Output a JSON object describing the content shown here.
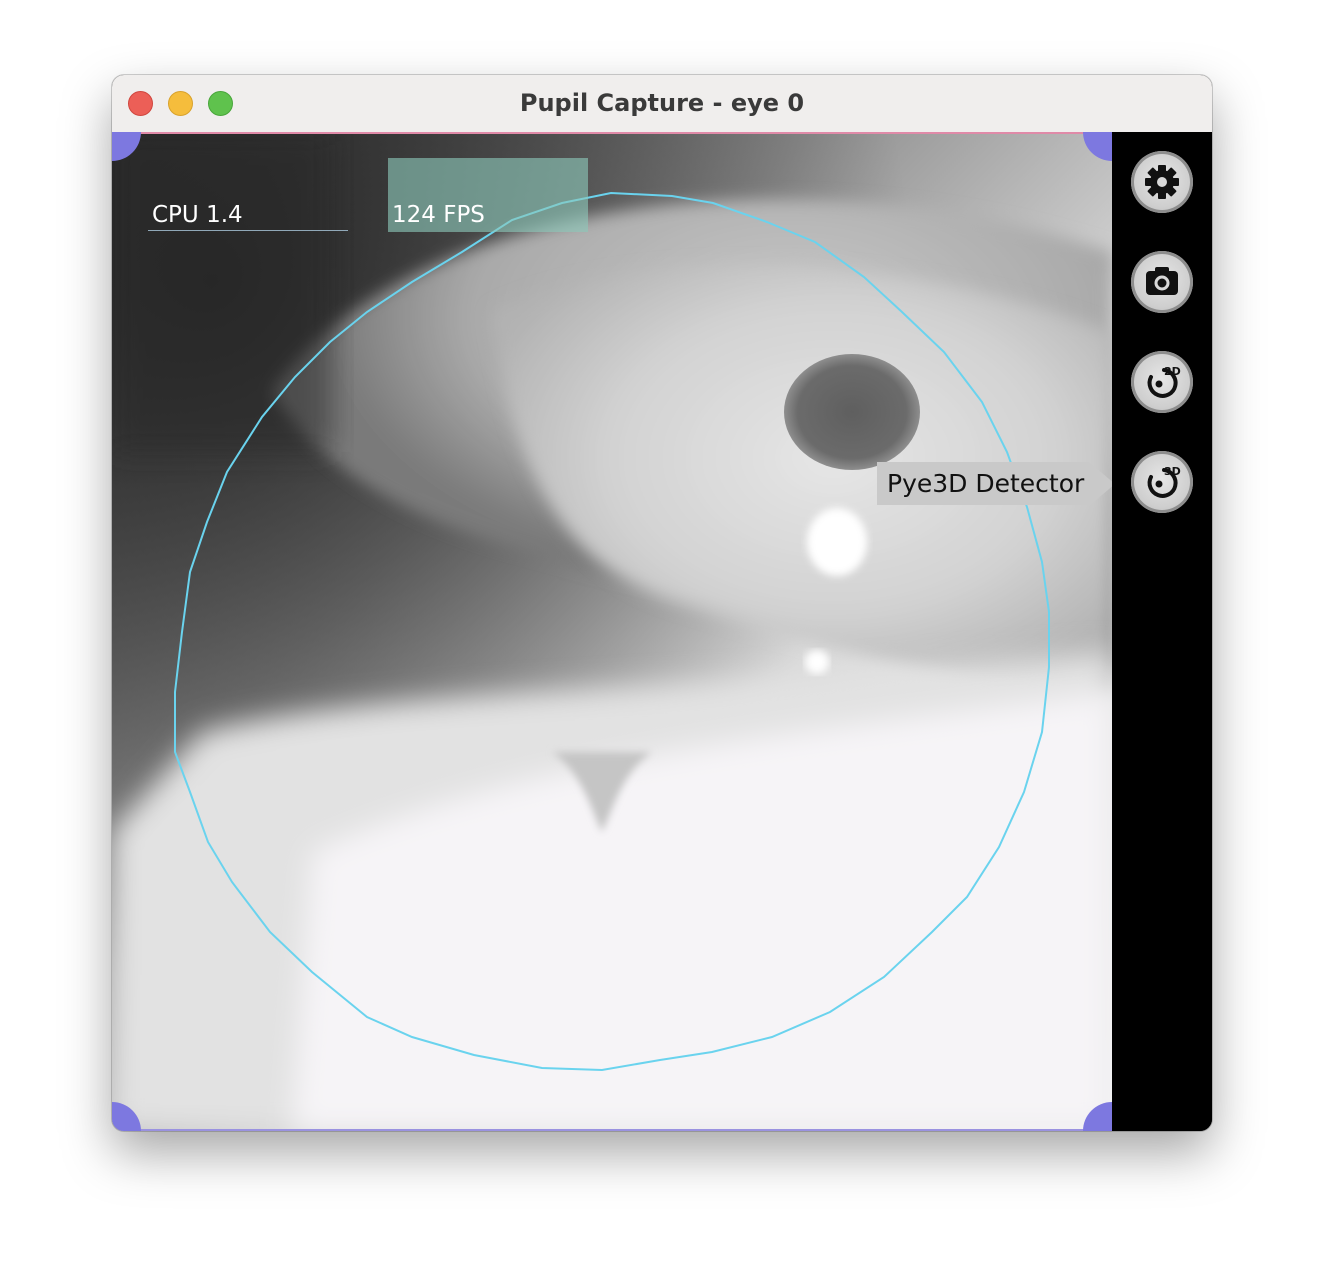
{
  "window": {
    "title": "Pupil Capture - eye 0"
  },
  "overlay": {
    "cpu_text": "CPU 1.4",
    "fps_text": "124 FPS"
  },
  "sidebar": {
    "buttons": [
      {
        "name": "settings",
        "icon": "gear-icon"
      },
      {
        "name": "snapshot",
        "icon": "camera-icon"
      },
      {
        "name": "detector-2d",
        "icon": "eye-2d-icon",
        "badge": "2D"
      },
      {
        "name": "detector-3d",
        "icon": "eye-3d-icon",
        "badge": "3D"
      }
    ],
    "tooltip": "Pye3D Detector"
  },
  "colors": {
    "eye_model_circle": "#6ad3ee",
    "corner_handles": "#7d78e0",
    "fps_highlight": "#8cc8b9",
    "sidebar_bg": "#000000"
  }
}
